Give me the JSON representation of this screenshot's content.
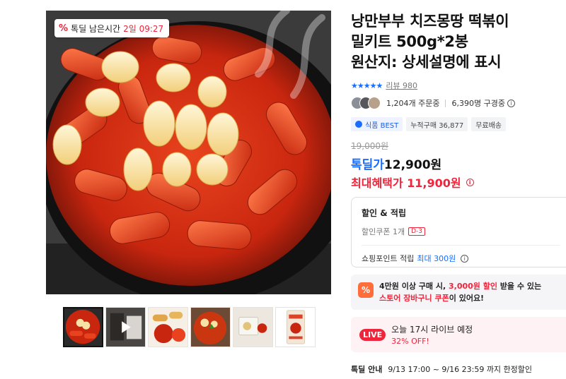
{
  "gallery": {
    "timer_icon": "%",
    "timer_label": "톡딜 남은시간",
    "timer_value": "2일 09:27",
    "thumbnails": [
      "thumb-tteokbokki",
      "thumb-video",
      "thumb-fried",
      "thumb-plate",
      "thumb-package",
      "thumb-box"
    ]
  },
  "product": {
    "title_line1": "낭만부부 치즈몽땅 떡볶이",
    "title_line2": "밀키트 500g*2봉",
    "title_line3": "원산지: 상세설명에 표시",
    "stars": "★★★★★",
    "review_label": "리뷰 980",
    "ordering": "1,204개 주문중",
    "subscribers": "6,390명 구경중",
    "tags": [
      "식품 BEST",
      "누적구매 36,877",
      "무료배송"
    ],
    "original_price": "19,000원",
    "deal_label": "톡딜가",
    "deal_price": "12,900원",
    "max_benefit": "최대혜택가 11,900원"
  },
  "benefits": {
    "heading": "할인 & 적립",
    "coupon_label": "할인쿠폰 1개",
    "coupon_dday": "D-3",
    "points_label": "쇼핑포인트 적립",
    "points_value": "최대 300원"
  },
  "promo": {
    "icon": "%",
    "line1_a": "4만원 이상 구매 시, ",
    "line1_b": "3,000원 할인",
    "line1_c": " 받을 수 있는",
    "line2_a": "스토어 장바구니 쿠폰",
    "line2_b": "이 있어요!"
  },
  "live": {
    "badge": "LIVE",
    "title": "오늘 17시 라이브 예정",
    "discount": "32% OFF!"
  },
  "deal_info": {
    "label": "톡딜 안내",
    "period": "9/13 17:00 ~ 9/16 23:59 까지 한정할인"
  },
  "colors": {
    "accent_blue": "#1a6dff",
    "accent_red": "#f0243b",
    "promo_orange": "#ff6d3a"
  }
}
